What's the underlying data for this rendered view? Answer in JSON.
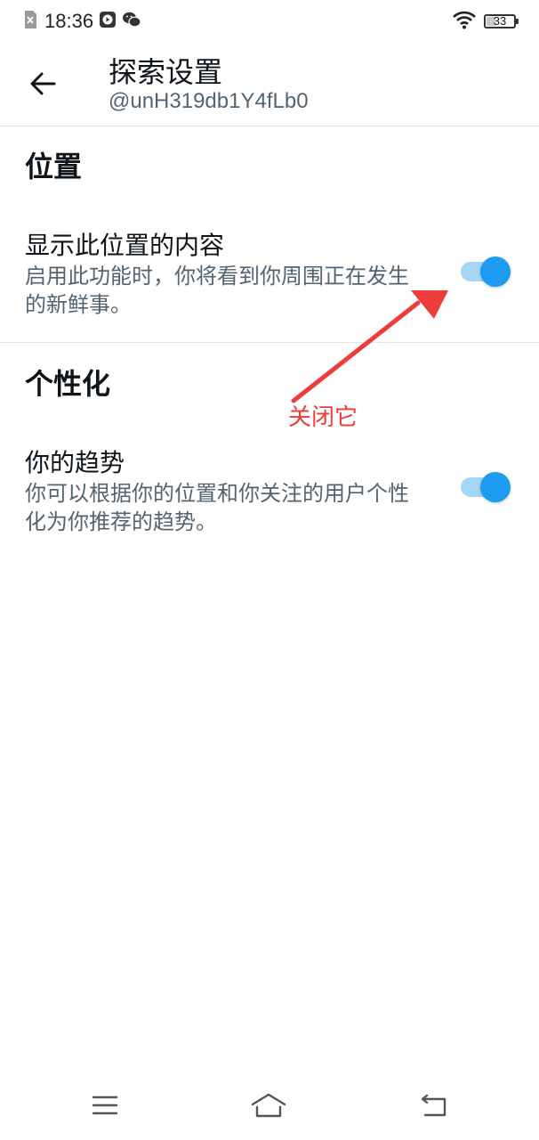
{
  "status_bar": {
    "time": "18:36",
    "battery": "33",
    "battery_level": 0.33,
    "icons": [
      "sim-off-icon",
      "media-play-icon",
      "wechat-icon",
      "wifi-icon",
      "battery-icon"
    ]
  },
  "header": {
    "title": "探索设置",
    "subtitle": "@unH319db1Y4fLb0",
    "back_icon": "arrow-left-icon"
  },
  "sections": [
    {
      "heading": "位置",
      "settings": [
        {
          "title": "显示此位置的内容",
          "description": "启用此功能时，你将看到你周围正在发生的新鲜事。",
          "enabled": true
        }
      ]
    },
    {
      "heading": "个性化",
      "settings": [
        {
          "title": "你的趋势",
          "description": "你可以根据你的位置和你关注的用户个性化为你推荐的趋势。",
          "enabled": true
        }
      ]
    }
  ],
  "annotation": {
    "label": "关闭它",
    "color": "#ee3b3b"
  },
  "colors": {
    "accent": "#1d9bf0",
    "toggle_track": "#a6d6f5",
    "secondary_text": "#536471"
  },
  "nav_bar": {
    "icons": [
      "menu-icon",
      "home-icon",
      "back-icon"
    ]
  }
}
